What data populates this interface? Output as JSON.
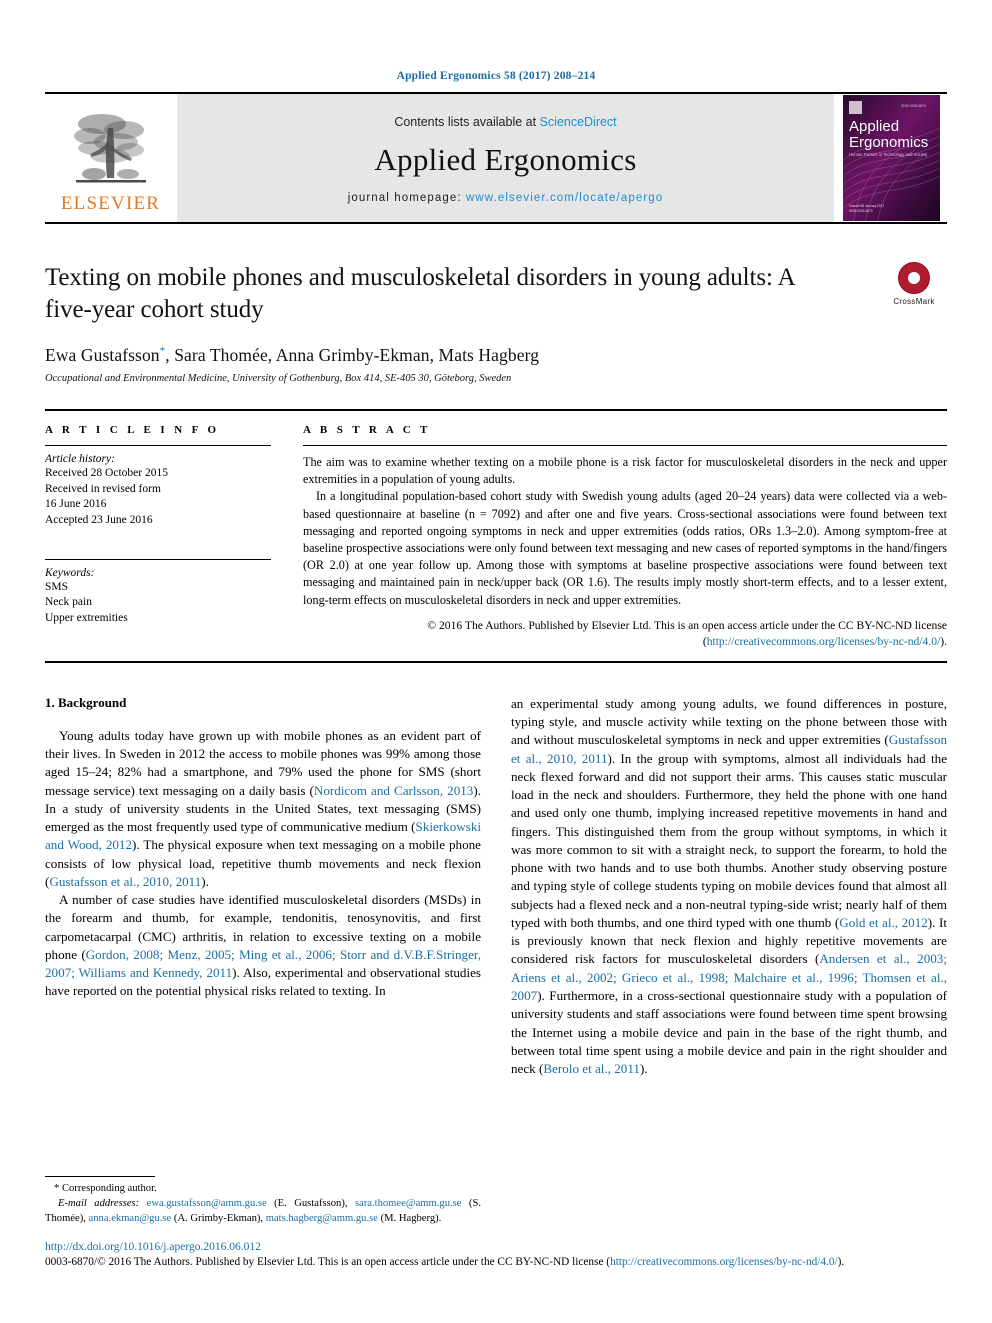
{
  "running_head": "Applied Ergonomics 58 (2017) 208–214",
  "masthead": {
    "publisher_logo_text": "ELSEVIER",
    "contents_prefix": "Contents lists available at ",
    "contents_link": "ScienceDirect",
    "journal_title": "Applied Ergonomics",
    "homepage_label": "journal homepage: ",
    "homepage_url": "www.elsevier.com/locate/apergo",
    "cover_title_line1": "Applied",
    "cover_title_line2": "Ergonomics",
    "cover_subtitle": "Human Factors in Technology and Society"
  },
  "article": {
    "title": "Texting on mobile phones and musculoskeletal disorders in young adults: A five-year cohort study",
    "crossmark_label": "CrossMark",
    "authors_pre": "Ewa Gustafsson",
    "authors_star": "*",
    "authors_post": ", Sara Thomée, Anna Grimby-Ekman, Mats Hagberg",
    "affiliation": "Occupational and Environmental Medicine, University of Gothenburg, Box 414, SE-405 30, Göteborg, Sweden"
  },
  "article_info": {
    "heading": "A R T I C L E   I N F O",
    "history_label": "Article history:",
    "history": [
      "Received 28 October 2015",
      "Received in revised form",
      "16 June 2016",
      "Accepted 23 June 2016"
    ],
    "keywords_label": "Keywords:",
    "keywords": [
      "SMS",
      "Neck pain",
      "Upper extremities"
    ]
  },
  "abstract": {
    "heading": "A B S T R A C T",
    "paragraph1": "The aim was to examine whether texting on a mobile phone is a risk factor for musculoskeletal disorders in the neck and upper extremities in a population of young adults.",
    "paragraph2": "In a longitudinal population-based cohort study with Swedish young adults (aged 20–24 years) data were collected via a web-based questionnaire at baseline (n = 7092) and after one and five years. Cross-sectional associations were found between text messaging and reported ongoing symptoms in neck and upper extremities (odds ratios, ORs 1.3–2.0). Among symptom-free at baseline prospective associations were only found between text messaging and new cases of reported symptoms in the hand/fingers (OR 2.0) at one year follow up. Among those with symptoms at baseline prospective associations were found between text messaging and maintained pain in neck/upper back (OR 1.6). The results imply mostly short-term effects, and to a lesser extent, long-term effects on musculoskeletal disorders in neck and upper extremities.",
    "copyright_text": "© 2016 The Authors. Published by Elsevier Ltd. This is an open access article under the CC BY-NC-ND license (",
    "copyright_link": "http://creativecommons.org/licenses/by-nc-nd/4.0/",
    "copyright_tail": ")."
  },
  "body": {
    "section_heading": "1. Background",
    "left_column": [
      {
        "segments": [
          {
            "t": "Young adults today have grown up with mobile phones as an evident part of their lives. In Sweden in 2012 the access to mobile phones was 99% among those aged 15–24; 82% had a smartphone, and 79% used the phone for SMS (short message service) text messaging on a daily basis (",
            "link": false
          },
          {
            "t": "Nordicom and Carlsson, 2013",
            "link": true
          },
          {
            "t": "). In a study of university students in the United States, text messaging (SMS) emerged as the most frequently used type of communicative medium (",
            "link": false
          },
          {
            "t": "Skierkowski and Wood, 2012",
            "link": true
          },
          {
            "t": "). The physical exposure when text messaging on a mobile phone consists of low physical load, repetitive thumb movements and neck flexion (",
            "link": false
          },
          {
            "t": "Gustafsson et al., 2010, 2011",
            "link": true
          },
          {
            "t": ").",
            "link": false
          }
        ]
      },
      {
        "segments": [
          {
            "t": "A number of case studies have identified musculoskeletal disorders (MSDs) in the forearm and thumb, for example, tendonitis, tenosynovitis, and first carpometacarpal (CMC) arthritis, in relation to excessive texting on a mobile phone (",
            "link": false
          },
          {
            "t": "Gordon, 2008; Menz, 2005; Ming et al., 2006; Storr and d.V.B.F.Stringer, 2007; Williams and Kennedy, 2011",
            "link": true
          },
          {
            "t": "). Also, experimental and observational studies have reported on the potential physical risks related to texting. In",
            "link": false
          }
        ]
      }
    ],
    "right_column": [
      {
        "segments": [
          {
            "t": "an experimental study among young adults, we found differences in posture, typing style, and muscle activity while texting on the phone between those with and without musculoskeletal symptoms in neck and upper extremities (",
            "link": false
          },
          {
            "t": "Gustafsson et al., 2010, 2011",
            "link": true
          },
          {
            "t": "). In the group with symptoms, almost all individuals had the neck flexed forward and did not support their arms. This causes static muscular load in the neck and shoulders. Furthermore, they held the phone with one hand and used only one thumb, implying increased repetitive movements in hand and fingers. This distinguished them from the group without symptoms, in which it was more common to sit with a straight neck, to support the forearm, to hold the phone with two hands and to use both thumbs. Another study observing posture and typing style of college students typing on mobile devices found that almost all subjects had a flexed neck and a non-neutral typing-side wrist; nearly half of them typed with both thumbs, and one third typed with one thumb (",
            "link": false
          },
          {
            "t": "Gold et al., 2012",
            "link": true
          },
          {
            "t": "). It is previously known that neck flexion and highly repetitive movements are considered risk factors for musculoskeletal disorders (",
            "link": false
          },
          {
            "t": "Andersen et al., 2003; Ariens et al., 2002; Grieco et al., 1998; Malchaire et al., 1996; Thomsen et al., 2007",
            "link": true
          },
          {
            "t": "). Furthermore, in a cross-sectional questionnaire study with a population of university students and staff associations were found between time spent browsing the Internet using a mobile device and pain in the base of the right thumb, and between total time spent using a mobile device and pain in the right shoulder and neck (",
            "link": false
          },
          {
            "t": "Berolo et al., 2011",
            "link": true
          },
          {
            "t": ").",
            "link": false
          }
        ]
      }
    ]
  },
  "footnote": {
    "corresponding_star": "*",
    "corresponding_text": " Corresponding author.",
    "email_label": "E-mail addresses:",
    "emails": [
      {
        "address": "ewa.gustafsson@amm.gu.se",
        "name": " (E. Gustafsson), "
      },
      {
        "address": "sara.thomee@amm.gu.se",
        "name": " (S. Thomée), "
      },
      {
        "address": "anna.ekman@gu.se",
        "name": " (A. Grimby-Ekman), "
      },
      {
        "address": "mats.hagberg@amm.gu.se",
        "name": " (M. Hagberg)."
      }
    ]
  },
  "page_footer": {
    "doi": "http://dx.doi.org/10.1016/j.apergo.2016.06.012",
    "issn_prefix": "0003-6870/© 2016 The Authors. Published by Elsevier Ltd. This is an open access article under the CC BY-NC-ND license (",
    "issn_link": "http://creativecommons.org/licenses/by-nc-nd/4.0/",
    "issn_tail": ")."
  },
  "colors": {
    "link": "#1a6ea5",
    "sciencedirect": "#1a8fd1",
    "elsevier_orange": "#e87722",
    "masthead_bg": "#e6e6e6",
    "crossmark_red": "#b01c2e"
  }
}
